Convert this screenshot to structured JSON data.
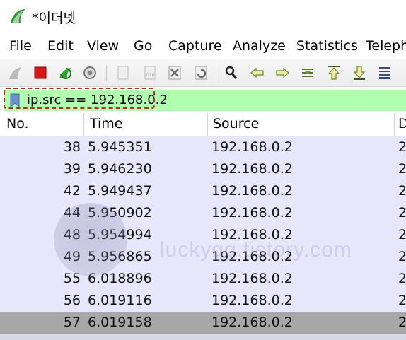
{
  "window": {
    "title": "*이더넷",
    "accent_color": "#2e9a2e"
  },
  "menu": {
    "items": [
      "File",
      "Edit",
      "View",
      "Go",
      "Capture",
      "Analyze",
      "Statistics",
      "Telephony"
    ]
  },
  "toolbar": {
    "icons": [
      "shark-fin-start-icon",
      "stop-icon",
      "restart-icon",
      "options-gear-icon",
      "open-file-icon",
      "save-file-icon",
      "close-file-icon",
      "reload-icon",
      "find-packet-icon",
      "go-back-icon",
      "go-forward-icon",
      "go-to-packet-icon",
      "go-first-icon",
      "go-last-icon",
      "autoscroll-icon"
    ]
  },
  "filter": {
    "value": "ip.src == 192.168.0.2",
    "background_color": "#afffaf"
  },
  "columns": {
    "no": "No.",
    "time": "Time",
    "source": "Source",
    "destination": "D"
  },
  "packets": [
    {
      "no": "38",
      "time": "5.945351",
      "source": "192.168.0.2",
      "dest": "2"
    },
    {
      "no": "39",
      "time": "5.946230",
      "source": "192.168.0.2",
      "dest": "2"
    },
    {
      "no": "42",
      "time": "5.949437",
      "source": "192.168.0.2",
      "dest": "2"
    },
    {
      "no": "44",
      "time": "5.950902",
      "source": "192.168.0.2",
      "dest": "2"
    },
    {
      "no": "48",
      "time": "5.954994",
      "source": "192.168.0.2",
      "dest": "2"
    },
    {
      "no": "49",
      "time": "5.956865",
      "source": "192.168.0.2",
      "dest": "2"
    },
    {
      "no": "55",
      "time": "6.018896",
      "source": "192.168.0.2",
      "dest": "2"
    },
    {
      "no": "56",
      "time": "6.019116",
      "source": "192.168.0.2",
      "dest": "2"
    },
    {
      "no": "57",
      "time": "6.019158",
      "source": "192.168.0.2",
      "dest": "2"
    },
    {
      "no": "",
      "time": "",
      "source": "",
      "dest": ""
    }
  ],
  "selected_row_index": 8,
  "watermark": {
    "text": "luckygg.tistory.com"
  }
}
